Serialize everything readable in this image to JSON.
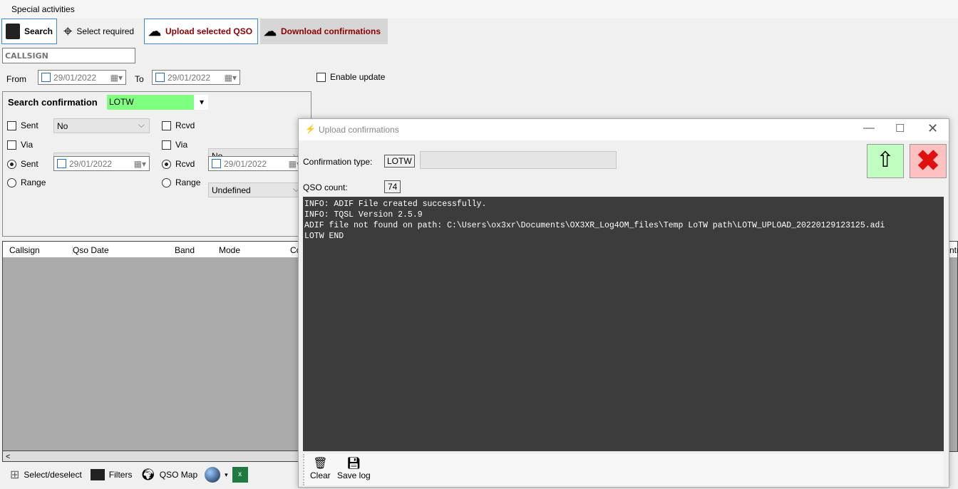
{
  "menu": {
    "special": "Special activities"
  },
  "toolbar": {
    "search": "Search",
    "select_required": "Select required",
    "upload": "Upload selected QSO",
    "download": "Download confirmations"
  },
  "filter": {
    "callsign_placeholder": "CALLSIGN",
    "from": "From",
    "to": "To",
    "from_date": "29/01/2022",
    "to_date": "29/01/2022",
    "enable_update": "Enable update"
  },
  "search_conf": {
    "title": "Search confirmation",
    "type": "LOTW",
    "type_color": "#80ff80",
    "sent": "Sent",
    "sent_value": "No",
    "via": "Via",
    "via_value": "Undefined",
    "rcvd": "Rcvd",
    "rcvd_value": "No",
    "rvia_value": "Undefined",
    "sent_date": "29/01/2022",
    "rcvd_date": "29/01/2022",
    "range": "Range"
  },
  "table": {
    "columns": [
      "Callsign",
      "Qso Date",
      "Band",
      "Mode",
      "Co"
    ],
    "right_col_fragment": "ntr"
  },
  "bottom": {
    "select": "Select/deselect",
    "filters": "Filters",
    "qso_map": "QSO Map"
  },
  "dialog": {
    "title": "Upload confirmations",
    "conf_type_label": "Confirmation type:",
    "conf_type": "LOTW",
    "qso_count_label": "QSO count:",
    "qso_count": "74",
    "log": [
      "INFO: ADIF File created successfully.",
      "INFO: TQSL Version 2.5.9",
      "ADIF file not found on path: C:\\Users\\ox3xr\\Documents\\OX3XR_Log4OM_files\\Temp LoTW path\\LOTW_UPLOAD_20220129123125.adi",
      "LOTW END"
    ],
    "clear": "Clear",
    "save_log": "Save log"
  }
}
